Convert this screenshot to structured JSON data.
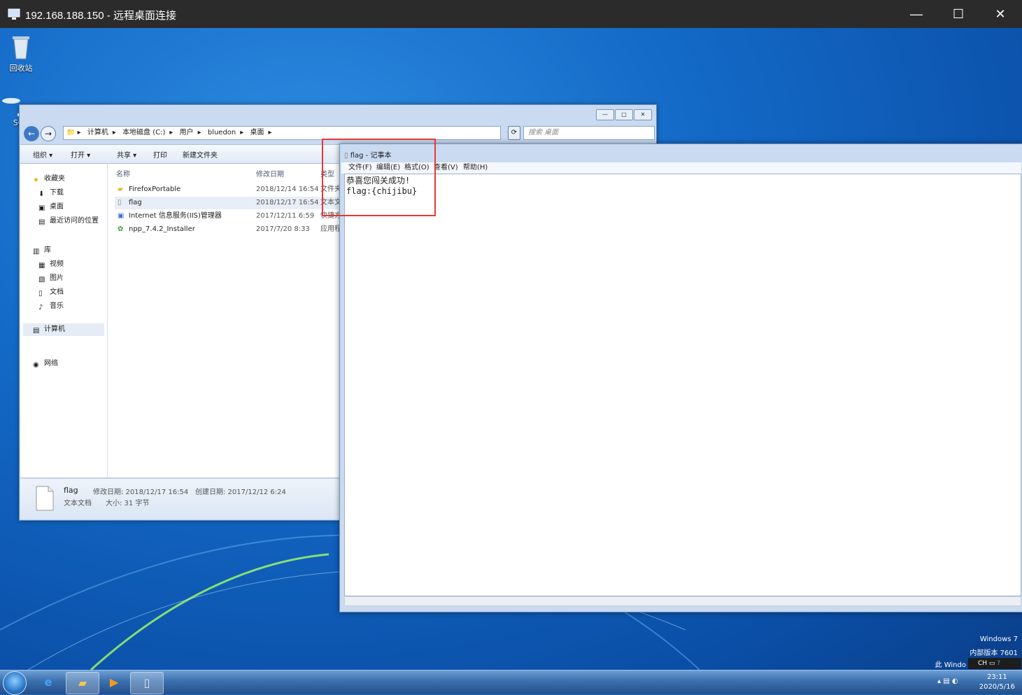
{
  "rdp": {
    "title": "192.168.188.150 - 远程桌面连接",
    "minimize": "—",
    "maximize": "☐",
    "close": "✕"
  },
  "desktop": {
    "icons": [
      {
        "label": "回收站"
      },
      {
        "label": "SQLy"
      }
    ],
    "watermark": {
      "line1": "Windows 7",
      "line2": "内部版本 7601",
      "line3": "此 Windo"
    }
  },
  "explorer": {
    "breadcrumb": [
      "计算机",
      "本地磁盘 (C:)",
      "用户",
      "bluedon",
      "桌面"
    ],
    "search_placeholder": "搜索 桌面",
    "toolbar": {
      "organize": "组织 ▾",
      "open": "打开 ▾",
      "share": "共享 ▾",
      "print": "打印",
      "new_folder": "新建文件夹"
    },
    "nav": {
      "favorites": "收藏夹",
      "downloads": "下载",
      "desktop": "桌面",
      "recent": "最近访问的位置",
      "libraries": "库",
      "videos": "视频",
      "pictures": "图片",
      "documents": "文档",
      "music": "音乐",
      "computer": "计算机",
      "network": "网络"
    },
    "columns": {
      "name": "名称",
      "modified": "修改日期",
      "type": "类型"
    },
    "files": [
      {
        "name": "FirefoxPortable",
        "modified": "2018/12/14 16:54",
        "type": "文件夹",
        "icon": "folder-icon"
      },
      {
        "name": "flag",
        "modified": "2018/12/17 16:54",
        "type": "文本文",
        "icon": "text-file-icon"
      },
      {
        "name": "Internet 信息服务(IIS)管理器",
        "modified": "2017/12/11 6:59",
        "type": "快捷方",
        "icon": "iis-icon"
      },
      {
        "name": "npp_7.4.2_Installer",
        "modified": "2017/7/20 8:33",
        "type": "应用程",
        "icon": "installer-icon"
      }
    ],
    "details": {
      "name": "flag",
      "kind": "文本文档",
      "modified": "修改日期: 2018/12/17 16:54",
      "created": "创建日期: 2017/12/12 6:24",
      "size": "大小: 31 字节"
    }
  },
  "notepad": {
    "title": "flag - 记事本",
    "menu": [
      "文件(F)",
      "编辑(E)",
      "格式(O)",
      "查看(V)",
      "帮助(H)"
    ],
    "content_line1": "恭喜您闯关成功!",
    "content_line2": "flag:{chijibu}"
  },
  "taskbar": {
    "clock_time": "23:11",
    "clock_date": "2020/5/16",
    "ime": "CH"
  }
}
